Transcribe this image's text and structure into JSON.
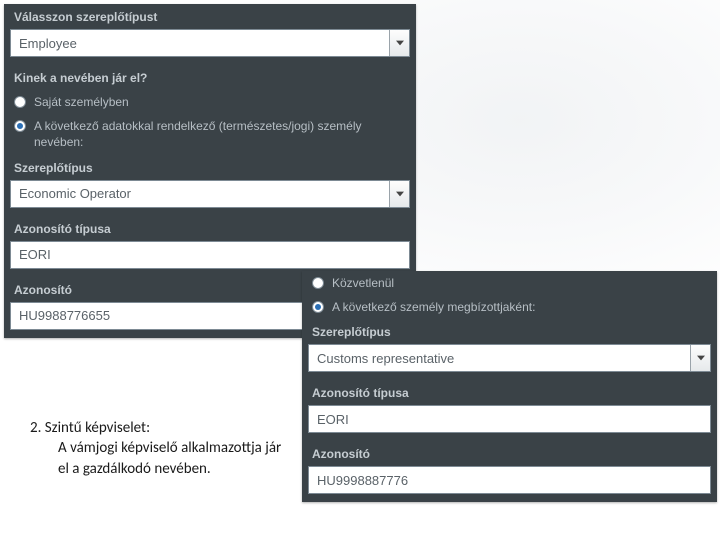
{
  "left_panel": {
    "label_role_type": "Válasszon szereplőtípust",
    "role_value": "Employee",
    "label_behalf": "Kinek a nevében jár el?",
    "radio_self": "Saját személyben",
    "radio_other": "A következő adatokkal rendelkező (természetes/jogi) személy nevében:",
    "label_actor_type": "Szereplőtípus",
    "actor_value": "Economic Operator",
    "label_id_type": "Azonosító típusa",
    "id_type_value": "EORI",
    "label_id": "Azonosító",
    "id_value": "HU9988776655"
  },
  "right_panel": {
    "radio_direct": "Közvetlenül",
    "radio_agent": "A következő személy megbízottjaként:",
    "label_actor_type": "Szereplőtípus",
    "actor_value": "Customs representative",
    "label_id_type": "Azonosító típusa",
    "id_type_value": "EORI",
    "label_id": "Azonosító",
    "id_value": "HU9998887776"
  },
  "note": {
    "line1": "2. Szintű képviselet:",
    "line2": "A vámjogi képviselő alkalmazottja jár el a gazdálkodó nevében."
  }
}
